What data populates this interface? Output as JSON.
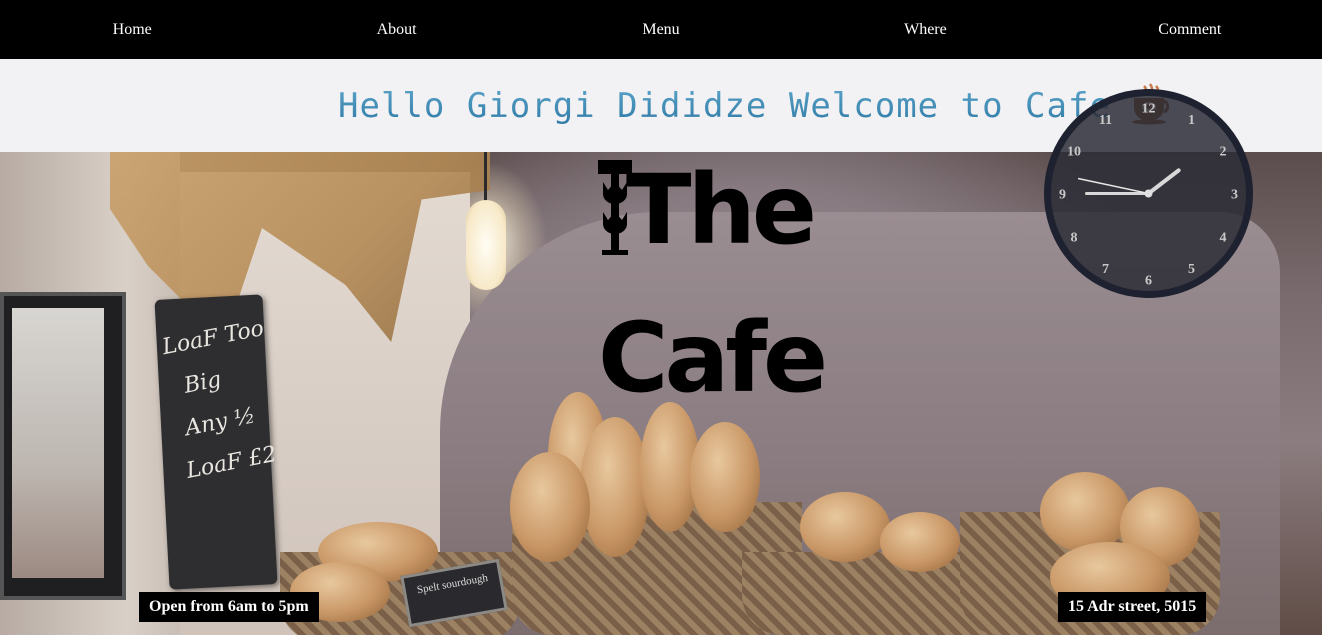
{
  "nav": {
    "items": [
      {
        "label": "Home"
      },
      {
        "label": "About"
      },
      {
        "label": "Menu"
      },
      {
        "label": "Where"
      },
      {
        "label": "Comment"
      }
    ]
  },
  "banner": {
    "greeting": "Hello Giorgi Dididze Welcome to Cafe",
    "icon": "coffee-cup-icon"
  },
  "hero": {
    "logo_line1": "The",
    "logo_line2": "Cafe",
    "chalkboard": "LoaF Too Big Any 1/2 LoaF £2",
    "sign": "Spelt sourdough"
  },
  "clock": {
    "numbers": [
      "12",
      "1",
      "2",
      "3",
      "4",
      "5",
      "6",
      "7",
      "8",
      "9",
      "10",
      "11"
    ],
    "hour": 1,
    "minute": 45,
    "second": 47
  },
  "info": {
    "hours": "Open from 6am to 5pm",
    "address": "15 Adr street, 5015"
  },
  "colors": {
    "nav_bg": "#000000",
    "banner_bg": "#f2f1f3",
    "greeting": "#3d87b0",
    "clock_face": "#2b2d36",
    "clock_rim": "#1e2230"
  }
}
